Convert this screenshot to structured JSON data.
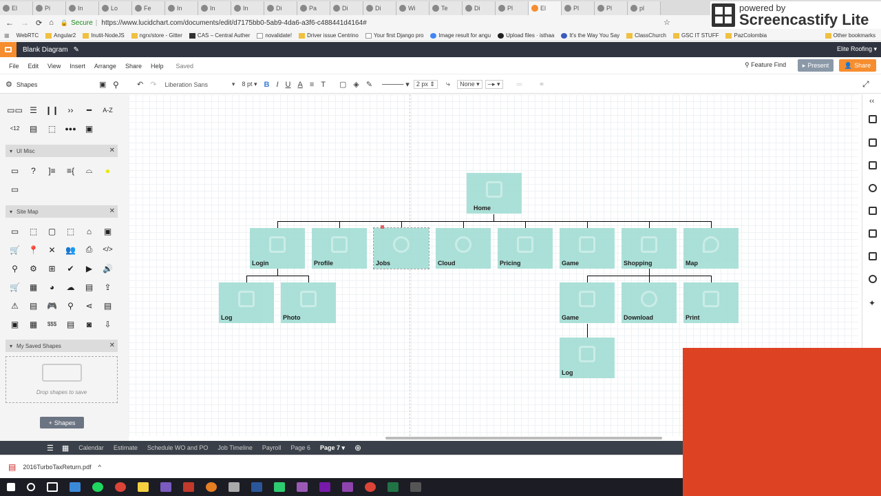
{
  "browser": {
    "tabs": [
      "El",
      "Pi",
      "In",
      "Lo",
      "Fe",
      "In",
      "In",
      "In",
      "Di",
      "Pa",
      "Di",
      "Di",
      "Wi",
      "Te",
      "Di",
      "Pl",
      "El",
      "Pl",
      "Pl",
      "pl"
    ],
    "secure_label": "Secure",
    "url": "https://www.lucidchart.com/documents/edit/d7175bb0-5ab9-4da6-a3f6-c488441d4164#",
    "bookmarks": [
      "WebRTC",
      "Angular2",
      "Inutit-NodeJS",
      "ngrx/store - Gitter",
      "CAS – Central Auther",
      "novalidate!",
      "Driver issue Centrino",
      "Your first Django pro",
      "Image result for angu",
      "Upload files · isthaa",
      "It's the Way You Say",
      "ClassChurch",
      "GSC IT STUFF",
      "PazColombia",
      "Other bookmarks"
    ]
  },
  "brand": {
    "powered": "powered by",
    "name": "Screencastify Lite"
  },
  "app": {
    "doc_title": "Blank Diagram",
    "account": "Elite Roofing",
    "menu": [
      "File",
      "Edit",
      "View",
      "Insert",
      "Arrange",
      "Share",
      "Help"
    ],
    "saved": "Saved",
    "feature_find": "Feature Find",
    "present": "Present",
    "share": "Share"
  },
  "toolbar": {
    "font": "Liberation Sans",
    "font_size": "8",
    "font_unit": "pt",
    "line_width": "2 px",
    "arrow_start": "None"
  },
  "sidebar": {
    "title": "Shapes",
    "sections": [
      {
        "title": "UI Misc"
      },
      {
        "title": "Site Map"
      },
      {
        "title": "My Saved Shapes"
      }
    ],
    "drop_text": "Drop shapes to save",
    "shapes_button": "Shapes"
  },
  "diagram": {
    "nodes": [
      "Home",
      "Login",
      "Profile",
      "Jobs",
      "Cloud",
      "Pricing",
      "Game",
      "Shopping",
      "Map",
      "Log",
      "Photo",
      "Game",
      "Download",
      "Print",
      "Log"
    ]
  },
  "pages": {
    "tabs": [
      "Calendar",
      "Estimate",
      "Schedule WO and PO",
      "Job Timeline",
      "Payroll",
      "Page 6",
      "Page 7"
    ],
    "active": "Page 7"
  },
  "download": {
    "file": "2016TurboTaxReturn.pdf"
  },
  "colors": {
    "accent": "#f68d2e",
    "node": "#a7dfd6",
    "overlay": "#dd4323",
    "appbar": "#2f3440"
  }
}
